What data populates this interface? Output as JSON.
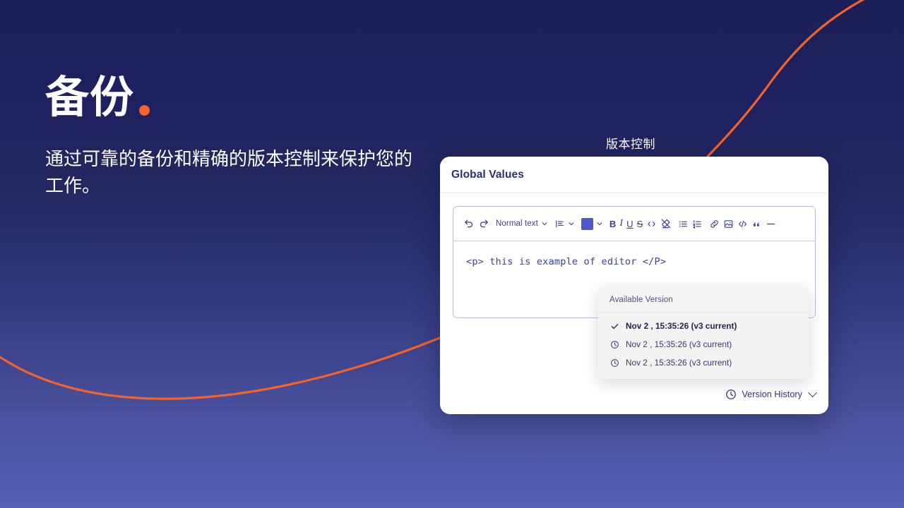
{
  "background": {
    "gradient_top": "#1d1f57",
    "gradient_bottom": "#5560b2",
    "accent_curve_color": "#f3632a"
  },
  "hero": {
    "title": "备份",
    "title_dot_color": "#f3632a",
    "subtitle": "通过可靠的备份和精确的版本控制来保护您的工作。"
  },
  "card": {
    "caption": "版本控制",
    "title": "Global Values",
    "editor": {
      "content": "<p> this is example of editor </P>",
      "toolbar": {
        "undo": "undo-icon",
        "redo": "redo-icon",
        "style_label": "Normal text",
        "align": "align-left-icon",
        "color_swatch": "#4f57cf",
        "bold": "B",
        "italic": "I",
        "underline": "U",
        "strikethrough": "S",
        "code_inline": "inline-code-icon",
        "clear_format": "clear-formatting-icon",
        "bullet_list": "bullet-list-icon",
        "numbered_list": "numbered-list-icon",
        "link": "link-icon",
        "image": "image-icon",
        "code_block": "code-block-icon",
        "quote": "quote-icon",
        "divider": "horizontal-rule-icon"
      }
    },
    "version_panel": {
      "header": "Available Version",
      "items": [
        {
          "label": "Nov 2 , 15:35:26 (v3 current)",
          "state": "current"
        },
        {
          "label": "Nov 2 , 15:35:26 (v3 current)",
          "state": "history"
        },
        {
          "label": "Nov 2 , 15:35:26 (v3 current)",
          "state": "history"
        }
      ]
    },
    "footer": {
      "version_history_label": "Version History"
    }
  }
}
